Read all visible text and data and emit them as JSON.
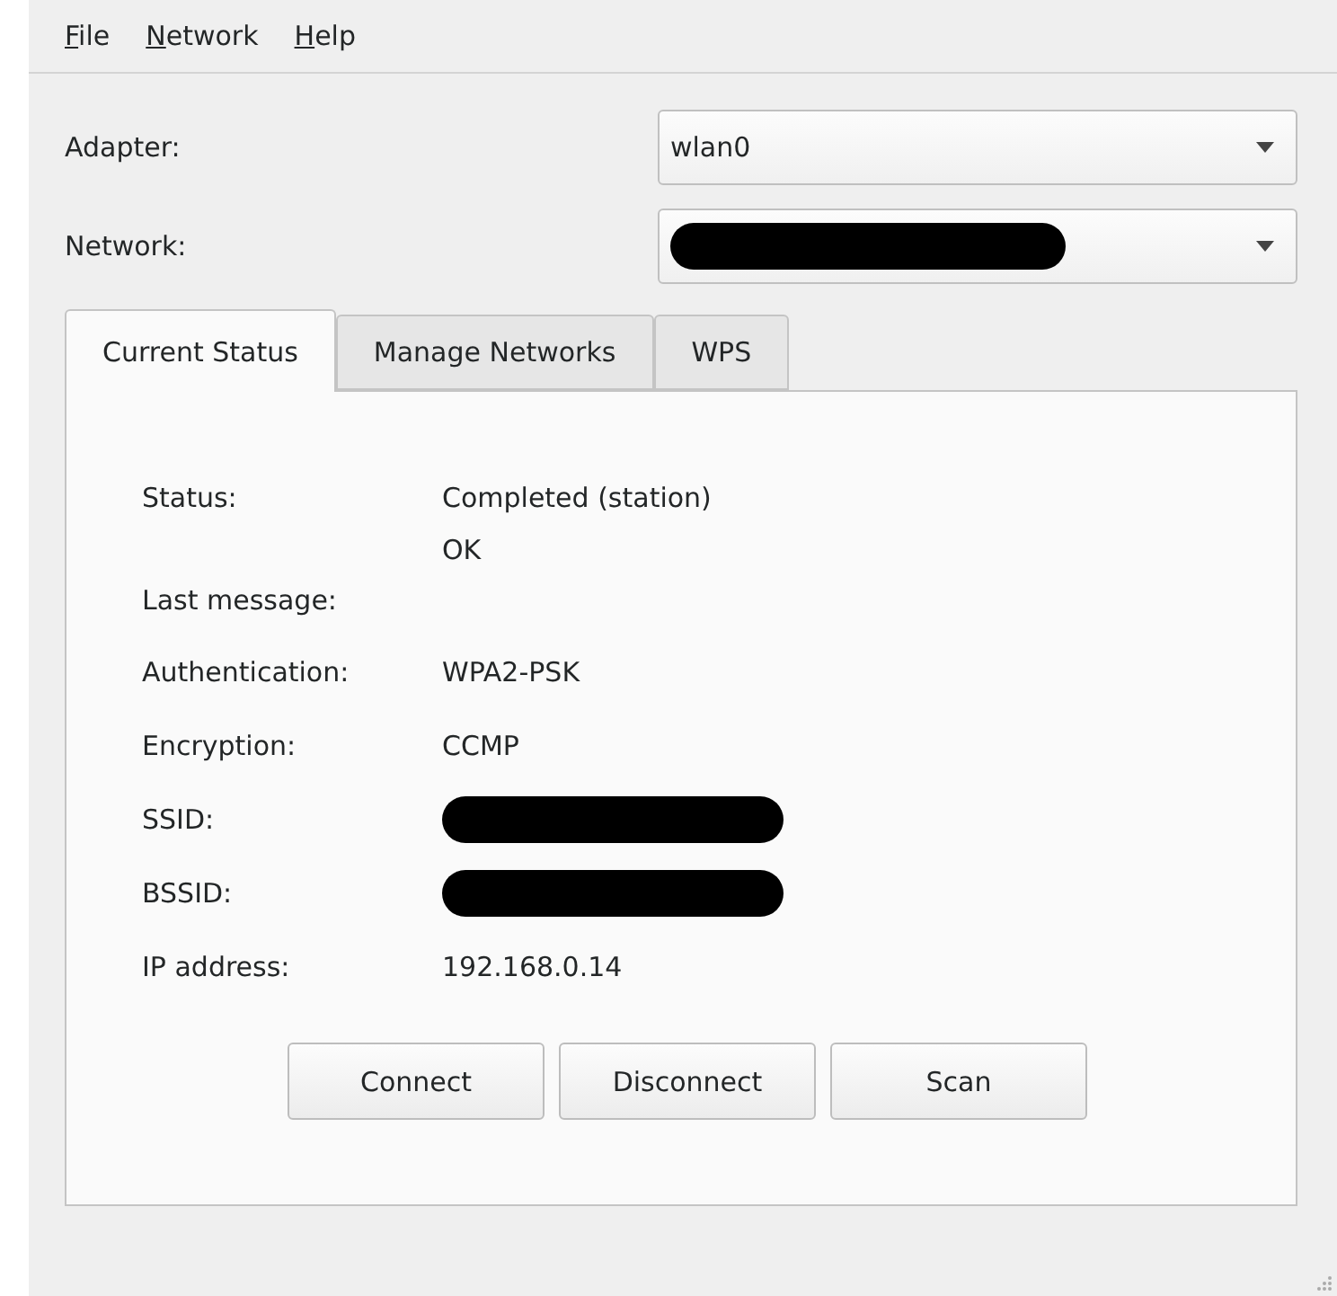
{
  "menu": [
    {
      "label": "File"
    },
    {
      "label": "Network"
    },
    {
      "label": "Help"
    }
  ],
  "selectors": [
    {
      "label": "Adapter:",
      "kind": "text",
      "value": "wlan0"
    },
    {
      "label": "Network:",
      "kind": "redacted"
    }
  ],
  "tabs": [
    {
      "label": "Current Status",
      "selected": true
    },
    {
      "label": "Manage Networks",
      "selected": false
    },
    {
      "label": "WPS",
      "selected": false
    }
  ],
  "status": [
    {
      "label": "Status:",
      "kind": "text",
      "value": "Completed (station)"
    },
    {
      "label": "Last message:",
      "kind": "tall",
      "value": "OK"
    },
    {
      "label": "Authentication:",
      "kind": "text",
      "value": "WPA2-PSK"
    },
    {
      "label": "Encryption:",
      "kind": "text",
      "value": "CCMP"
    },
    {
      "label": "SSID:",
      "kind": "redacted"
    },
    {
      "label": "BSSID:",
      "kind": "redacted"
    },
    {
      "label": "IP address:",
      "kind": "text",
      "value": "192.168.0.14"
    }
  ],
  "buttons": [
    "Connect",
    "Disconnect",
    "Scan"
  ]
}
